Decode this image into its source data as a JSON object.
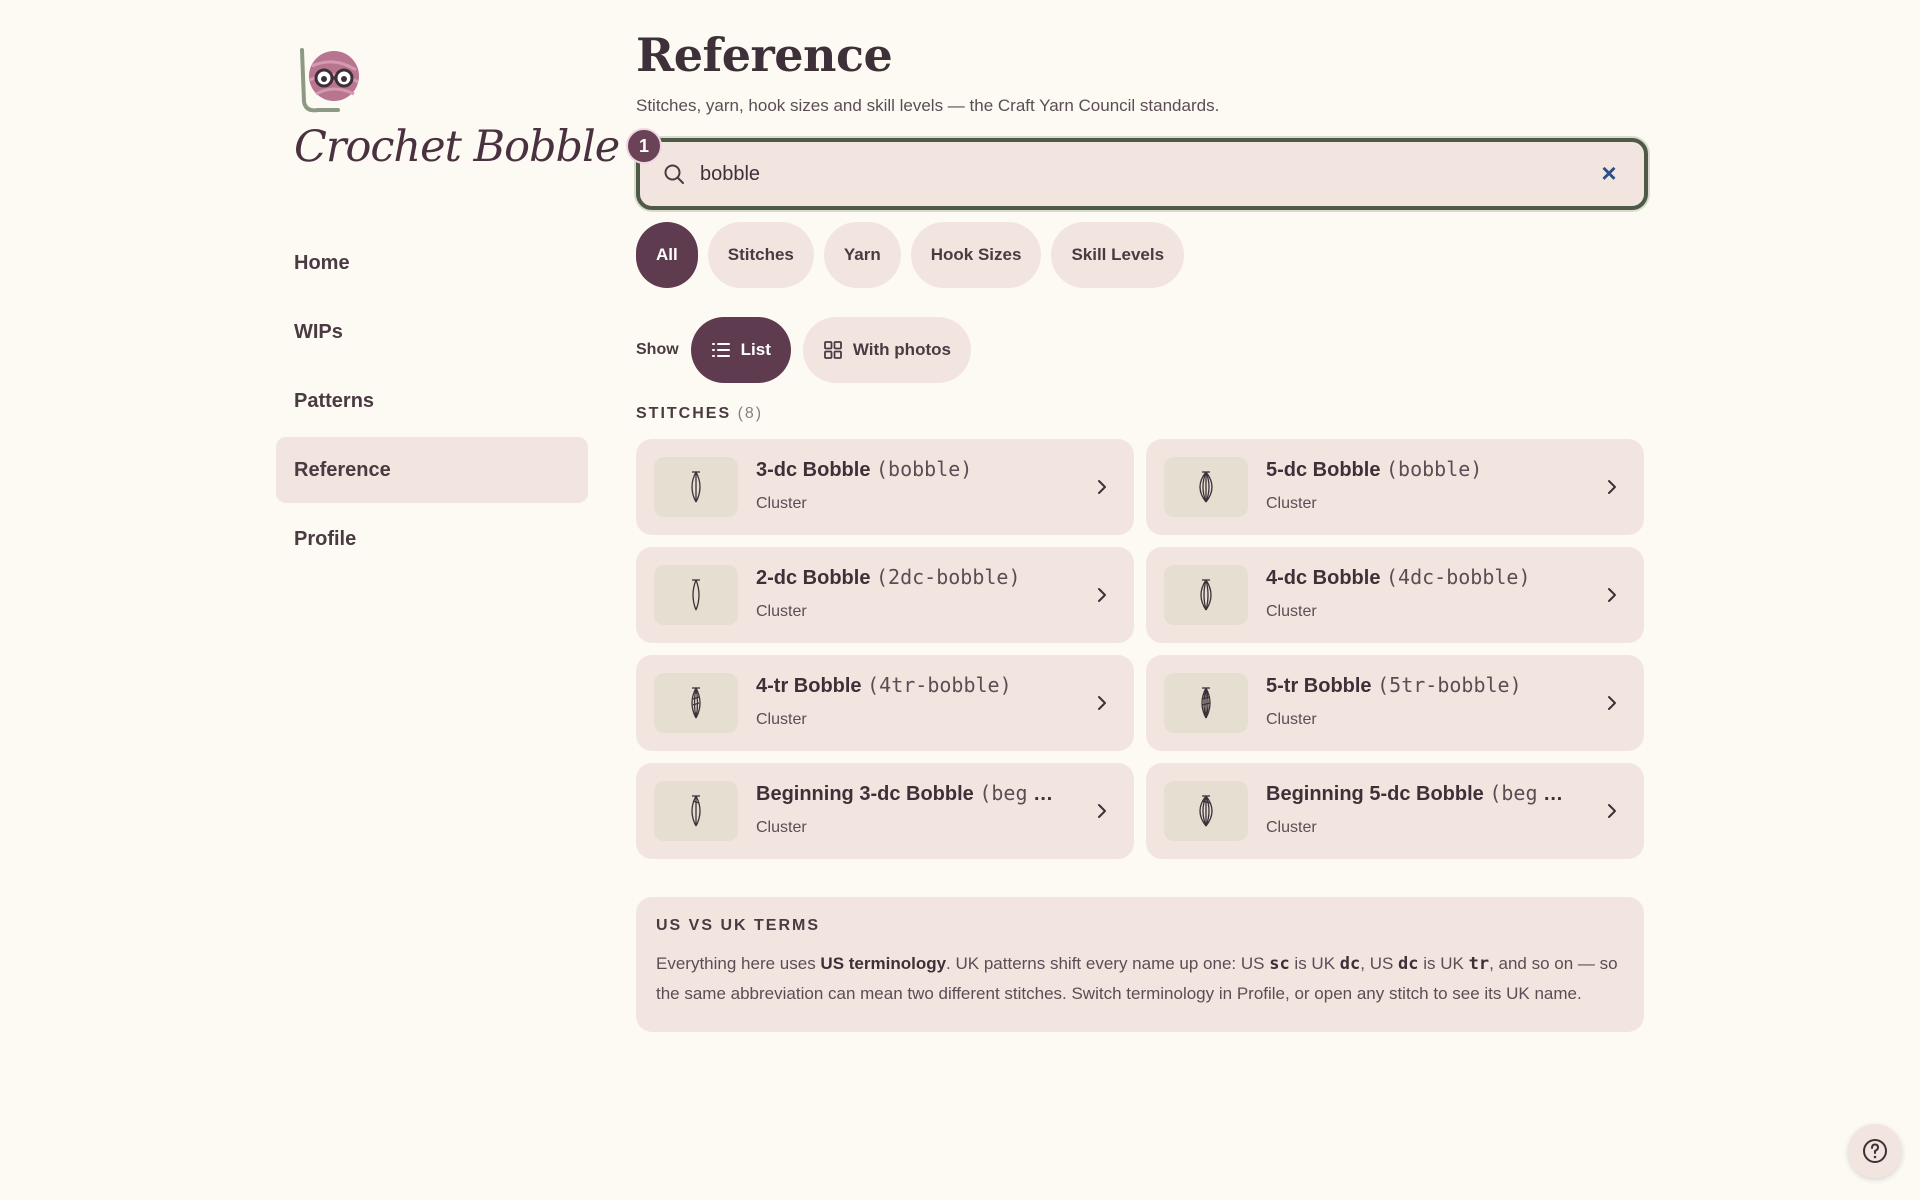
{
  "brand": {
    "name": "Crochet Bobble",
    "logo_icon": "yarn-ball-glasses-icon"
  },
  "nav": {
    "items": [
      {
        "label": "Home",
        "active": false
      },
      {
        "label": "WIPs",
        "active": false
      },
      {
        "label": "Patterns",
        "active": false
      },
      {
        "label": "Reference",
        "active": true
      },
      {
        "label": "Profile",
        "active": false
      }
    ]
  },
  "page": {
    "title": "Reference",
    "subtitle": "Stitches, yarn, hook sizes and skill levels — the Craft Yarn Council standards."
  },
  "search": {
    "value": "bobble",
    "badge": "1",
    "placeholder": ""
  },
  "filters": [
    {
      "label": "All",
      "active": true
    },
    {
      "label": "Stitches",
      "active": false
    },
    {
      "label": "Yarn",
      "active": false
    },
    {
      "label": "Hook Sizes",
      "active": false
    },
    {
      "label": "Skill Levels",
      "active": false
    }
  ],
  "view": {
    "show_label": "Show",
    "list_label": "List",
    "photos_label": "With photos",
    "selected": "List"
  },
  "stitches": {
    "title": "STITCHES",
    "count": "(8)",
    "items": [
      {
        "name": "3-dc Bobble",
        "abbr": "(bobble)",
        "category": "Cluster"
      },
      {
        "name": "5-dc Bobble",
        "abbr": "(bobble)",
        "category": "Cluster"
      },
      {
        "name": "2-dc Bobble",
        "abbr": "(2dc-bobble)",
        "category": "Cluster"
      },
      {
        "name": "4-dc Bobble",
        "abbr": "(4dc-bobble)",
        "category": "Cluster"
      },
      {
        "name": "4-tr Bobble",
        "abbr": "(4tr-bobble)",
        "category": "Cluster"
      },
      {
        "name": "5-tr Bobble",
        "abbr": "(5tr-bobble)",
        "category": "Cluster"
      },
      {
        "name": "Beginning 3-dc Bobble",
        "abbr": "(beg",
        "category": "Cluster"
      },
      {
        "name": "Beginning 5-dc Bobble",
        "abbr": "(beg",
        "category": "Cluster"
      }
    ]
  },
  "note": {
    "title": "US VS UK TERMS",
    "body_1": "Everything here uses ",
    "body_bold": "US terminology",
    "body_2": ". UK patterns shift every name up one: US ",
    "t_sc": "sc",
    "body_3": " is UK ",
    "t_dc1": "dc",
    "body_4": ", US ",
    "t_dc2": "dc",
    "body_5": " is UK ",
    "t_tr": "tr",
    "body_6": ", and so on — so the same abbreviation can mean two different stitches. Switch terminology in Profile, or open any stitch to see its UK name."
  },
  "colors": {
    "accent": "#5e3b4e",
    "surface": "#f2e5e0",
    "background": "#fdfaf4",
    "focus_ring": "#4e5a46"
  }
}
